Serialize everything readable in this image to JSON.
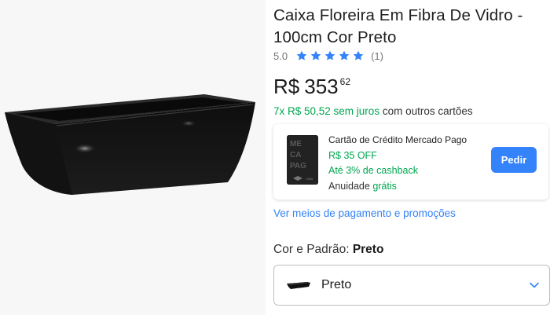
{
  "product": {
    "title": "Caixa Floreira Em Fibra De Vidro - 100cm Cor Preto",
    "rating": "5.0",
    "reviews": "(1)",
    "stars": 5,
    "currency": "R$",
    "price_int": "353",
    "price_cents": "62",
    "installments_highlight": "7x R$ 50,52 sem juros",
    "installments_rest": "com outros cartões"
  },
  "card_offer": {
    "title": "Cartão de Crédito Mercado Pago",
    "discount": "R$ 35 OFF",
    "cashback": "Até 3% de cashback",
    "annuity_label": "Anuidade",
    "annuity_value": "grátis",
    "button_label": "Pedir",
    "card_art_text": [
      "ME",
      "CA",
      "PAG",
      "VISA"
    ]
  },
  "payment_link": "Ver meios de pagamento e promoções",
  "variant": {
    "label": "Cor e Padrão:",
    "selected": "Preto",
    "dropdown_value": "Preto"
  },
  "colors": {
    "accent_blue": "#3483fa",
    "green": "#00a650",
    "image_bg": "#f7f7f7"
  },
  "icons": {
    "rating": "star-icon",
    "dropdown": "chevron-down-icon"
  }
}
